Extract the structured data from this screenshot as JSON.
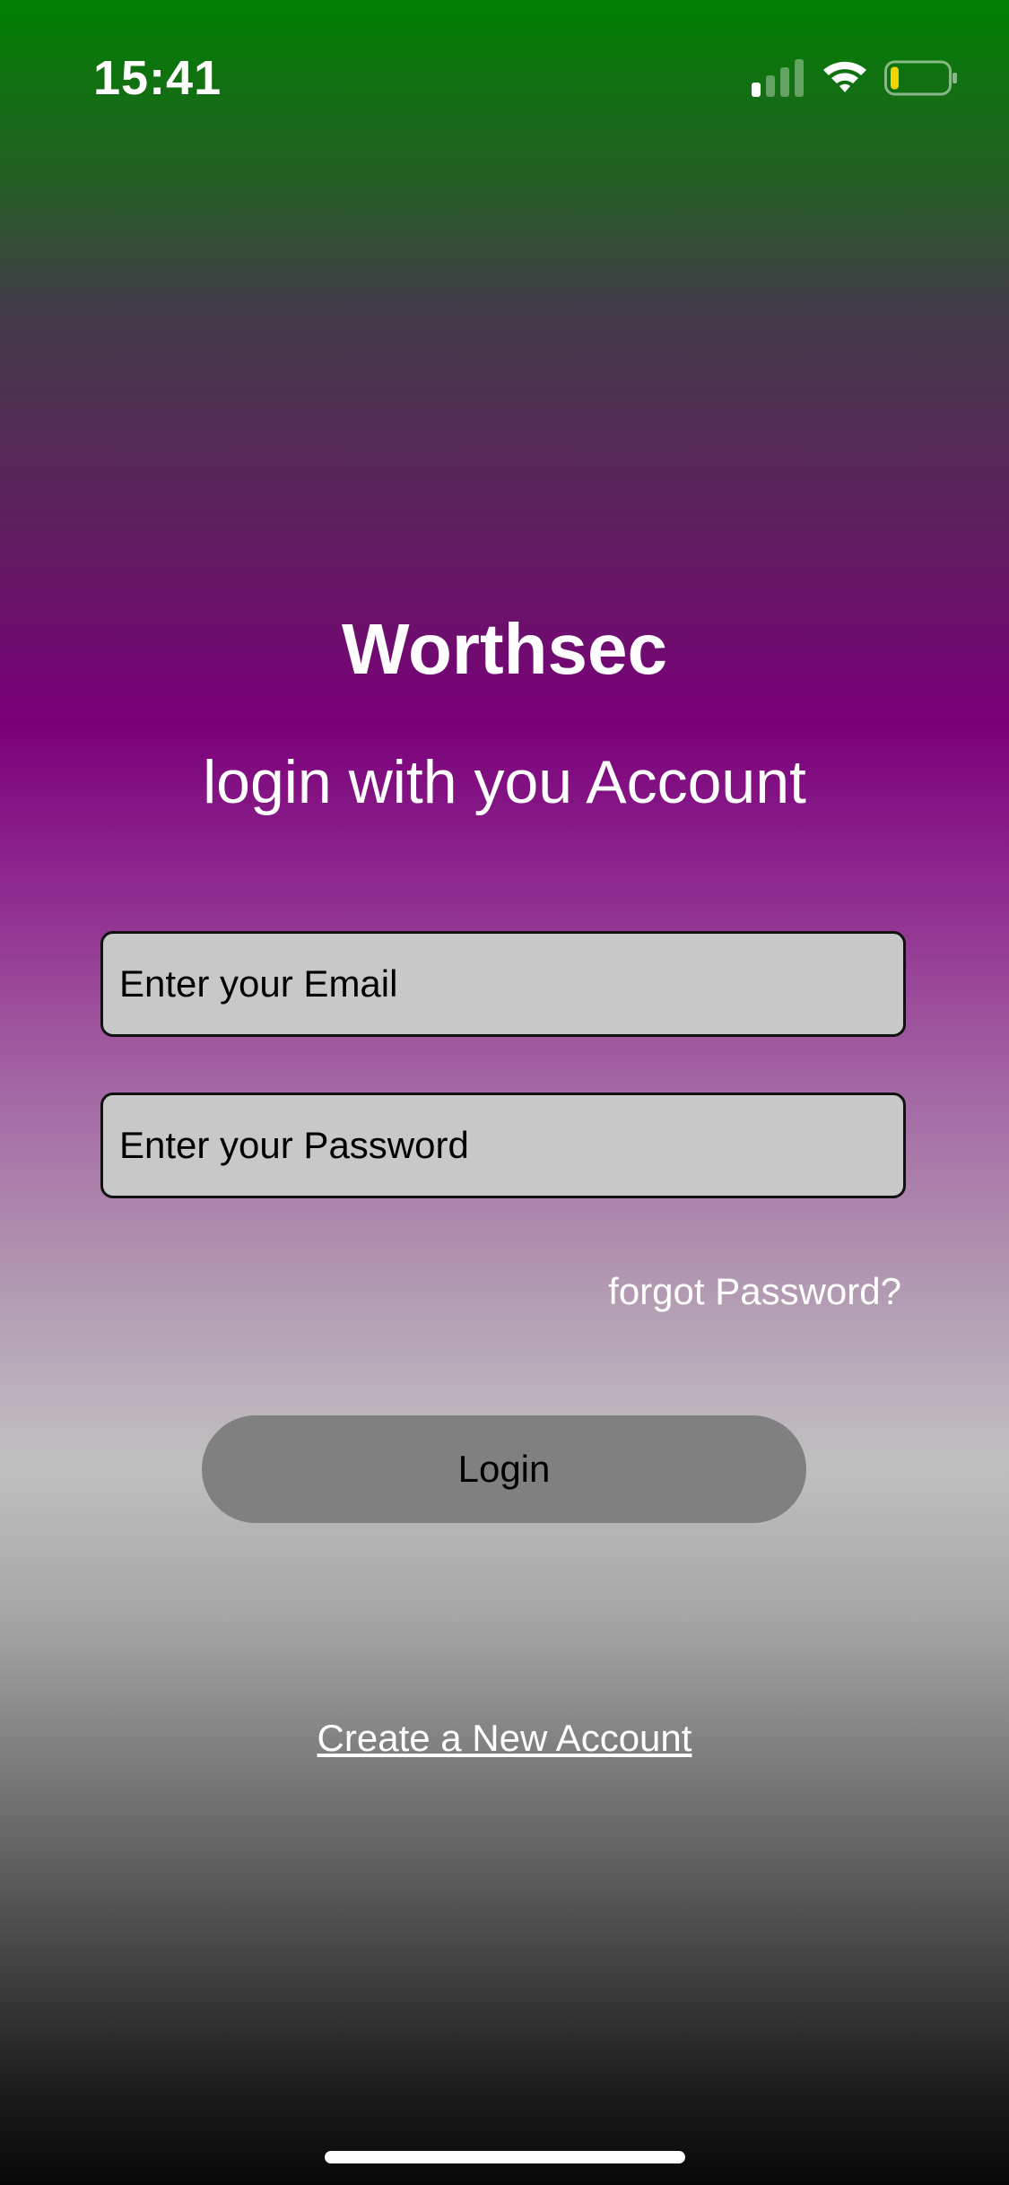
{
  "status_bar": {
    "time": "15:41",
    "icons": {
      "signal": "cellular-signal-icon",
      "wifi": "wifi-icon",
      "battery": "battery-low-icon"
    },
    "battery_level": 0.15
  },
  "header": {
    "title": "Worthsec",
    "subtitle": "login with you Account"
  },
  "form": {
    "email_placeholder": "Enter your Email",
    "email_value": "",
    "password_placeholder": "Enter your Password",
    "password_value": "",
    "forgot_label": "forgot Password?",
    "login_label": "Login"
  },
  "footer": {
    "create_account_label": "Create a New Account"
  },
  "colors": {
    "gradient_top": "#008000",
    "gradient_mid": "#800080",
    "gradient_light": "#c0c0c0",
    "gradient_bottom": "#000000",
    "input_bg": "#c8c8c8",
    "button_bg": "#808080",
    "battery_fill": "#f2d500"
  }
}
